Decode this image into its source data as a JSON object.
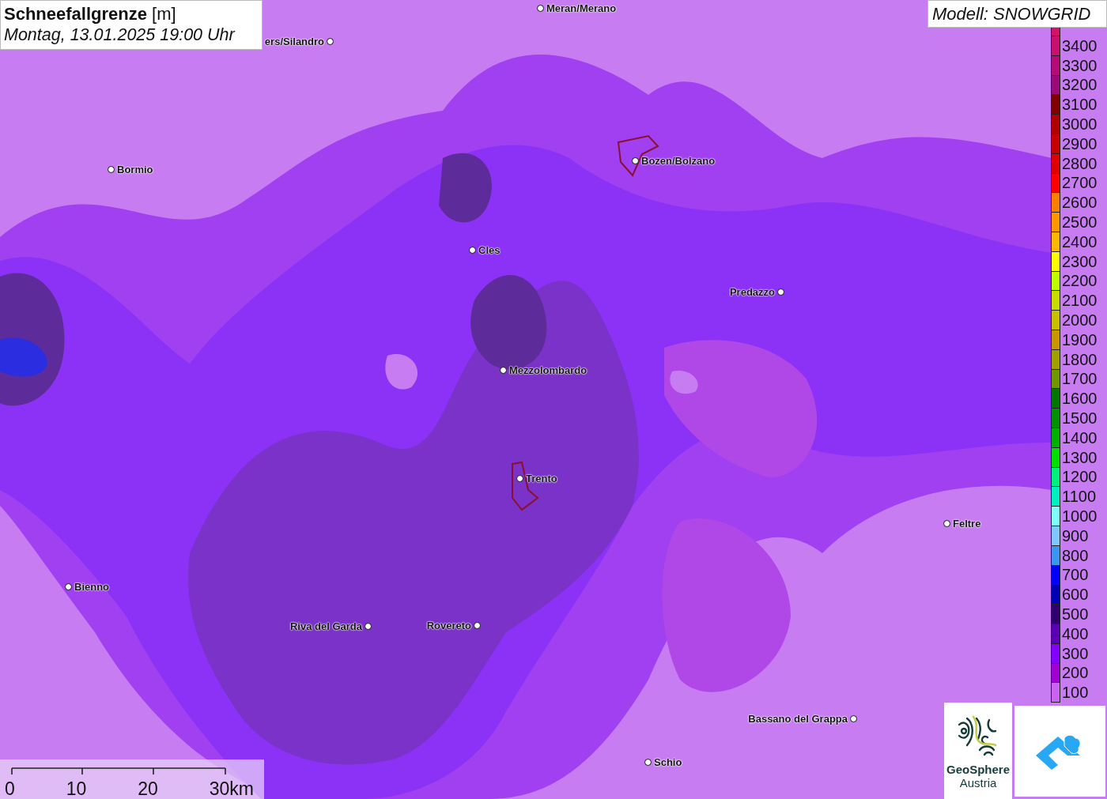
{
  "title": "**Schneefallgrenze** [m]",
  "datetime": "Montag, 13.01.2025 19:00 Uhr",
  "model": "Modell: SNOWGRID",
  "cities": [
    {
      "name": "Meran/Merano"
    },
    {
      "name": "ers/Silandro"
    },
    {
      "name": "Bormio"
    },
    {
      "name": "Bozen/Bolzano"
    },
    {
      "name": "Cles"
    },
    {
      "name": "Predazzo"
    },
    {
      "name": "Mezzolombardo"
    },
    {
      "name": "Trento"
    },
    {
      "name": "Feltre"
    },
    {
      "name": "Bienno"
    },
    {
      "name": "Riva del Garda"
    },
    {
      "name": "Rovereto"
    },
    {
      "name": "Bassano del Grappa"
    },
    {
      "name": "Schio"
    }
  ],
  "legend": [
    {
      "label": "3400",
      "color": "#c8106e"
    },
    {
      "label": "3300",
      "color": "#b40c74"
    },
    {
      "label": "3200",
      "color": "#9a0a78"
    },
    {
      "label": "3100",
      "color": "#800000"
    },
    {
      "label": "3000",
      "color": "#b00000"
    },
    {
      "label": "2900",
      "color": "#c80000"
    },
    {
      "label": "2800",
      "color": "#e00000"
    },
    {
      "label": "2700",
      "color": "#ff0000"
    },
    {
      "label": "2600",
      "color": "#ff8000"
    },
    {
      "label": "2500",
      "color": "#ff9800"
    },
    {
      "label": "2400",
      "color": "#ffb800"
    },
    {
      "label": "2300",
      "color": "#ffff00"
    },
    {
      "label": "2200",
      "color": "#c0ff00"
    },
    {
      "label": "2100",
      "color": "#c8dc00"
    },
    {
      "label": "2000",
      "color": "#c8c000"
    },
    {
      "label": "1900",
      "color": "#c89600"
    },
    {
      "label": "1800",
      "color": "#a0a000"
    },
    {
      "label": "1700",
      "color": "#709800"
    },
    {
      "label": "1600",
      "color": "#007800"
    },
    {
      "label": "1500",
      "color": "#009000"
    },
    {
      "label": "1400",
      "color": "#00b000"
    },
    {
      "label": "1300",
      "color": "#00e000"
    },
    {
      "label": "1200",
      "color": "#00f080"
    },
    {
      "label": "1100",
      "color": "#00f0c0"
    },
    {
      "label": "1000",
      "color": "#80ffff"
    },
    {
      "label": "900",
      "color": "#80c8ff"
    },
    {
      "label": "800",
      "color": "#3c96f0"
    },
    {
      "label": "700",
      "color": "#0000ff"
    },
    {
      "label": "600",
      "color": "#0000b4"
    },
    {
      "label": "500",
      "color": "#32006e"
    },
    {
      "label": "400",
      "color": "#5a00b4"
    },
    {
      "label": "300",
      "color": "#8200ff"
    },
    {
      "label": "200",
      "color": "#a000d2"
    },
    {
      "label": "100",
      "color": "#c864f0"
    }
  ],
  "scale_bar": {
    "labels": [
      "0",
      "10",
      "20",
      "30km"
    ]
  },
  "logo": {
    "name": "GeoSphere",
    "subtitle": "Austria"
  }
}
